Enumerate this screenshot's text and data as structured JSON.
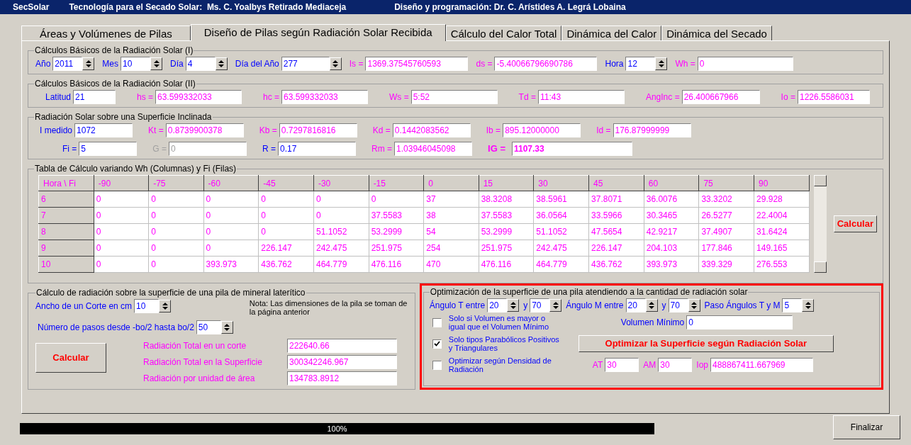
{
  "title_bar": {
    "app": "SecSolar",
    "subtitle": "Tecnología para el Secado Solar:  Ms. C. Yoalbys Retirado Mediaceja",
    "credits": "Diseño y programación: Dr. C. Arístides A. Legrá Lobaina"
  },
  "tabs": [
    {
      "label": "Áreas y Volúmenes de Pilas",
      "selected": false
    },
    {
      "label": "Diseño de Pilas según Radiación Solar Recibida",
      "selected": true
    },
    {
      "label": "Cálculo del Calor Total",
      "selected": false
    },
    {
      "label": "Dinámica del Calor",
      "selected": false
    },
    {
      "label": "Dinámica del Secado",
      "selected": false
    }
  ],
  "basic_1": {
    "title": "Cálculos Básicos de la Radiación Solar (I)",
    "fields": [
      {
        "label": "Año",
        "value": "2011",
        "kind": "spin"
      },
      {
        "label": "Mes",
        "value": "10",
        "kind": "spin"
      },
      {
        "label": "Día",
        "value": "4",
        "kind": "spin"
      },
      {
        "label": "Día del Año",
        "value": "277",
        "kind": "spin"
      },
      {
        "label": "Is =",
        "value": "1369.37545760593",
        "kind": "output"
      },
      {
        "label": "ds =",
        "value": "-5.40066796690786",
        "kind": "output"
      },
      {
        "label": "Hora",
        "value": "12",
        "kind": "spin"
      },
      {
        "label": "Wh =",
        "value": "0",
        "kind": "output"
      }
    ]
  },
  "basic_2": {
    "title": "Cálculos Básicos de la Radiación Solar (II)",
    "fields": [
      {
        "label": "Latitud",
        "value": "21",
        "kind": "input"
      },
      {
        "label": "hs =",
        "value": "63.599332033",
        "kind": "output"
      },
      {
        "label": "hc =",
        "value": "63.599332033",
        "kind": "output"
      },
      {
        "label": "Ws =",
        "value": "5:52",
        "kind": "output"
      },
      {
        "label": "Td =",
        "value": "11:43",
        "kind": "output"
      },
      {
        "label": "AngInc =",
        "value": "26.400667966",
        "kind": "output"
      },
      {
        "label": "Io =",
        "value": "1226.5586031",
        "kind": "output"
      }
    ]
  },
  "inclined": {
    "title": "Radiación Solar sobre una Superficie Inclinada",
    "rows": [
      [
        {
          "label": "I medido",
          "value": "1072",
          "kind": "input"
        },
        {
          "label": "Kt =",
          "value": "0.8739900378",
          "kind": "output"
        },
        {
          "label": "Kb =",
          "value": "0.7297816816",
          "kind": "output"
        },
        {
          "label": "Kd =",
          "value": "0.1442083562",
          "kind": "output"
        },
        {
          "label": "Ib =",
          "value": "895.12000000",
          "kind": "output"
        },
        {
          "label": "Id =",
          "value": "176.87999999",
          "kind": "output"
        }
      ],
      [
        {
          "label": "Fi =",
          "value": "5",
          "kind": "input"
        },
        {
          "label": "G =",
          "value": "0",
          "kind": "disabled"
        },
        {
          "label": "R =",
          "value": "0.17",
          "kind": "input"
        },
        {
          "label": "Rm =",
          "value": "1.03946045098",
          "kind": "output"
        },
        {
          "label": "IG =",
          "value": "1107.33",
          "kind": "result"
        }
      ]
    ]
  },
  "table": {
    "title": "Tabla de Cálculo variando Wh (Columnas) y Fi (Filas)",
    "columns": [
      "Hora \\ Fi",
      "-90",
      "-75",
      "-60",
      "-45",
      "-30",
      "-15",
      "0",
      "15",
      "30",
      "45",
      "60",
      "75",
      "90"
    ],
    "rows": [
      {
        "cells": [
          "6",
          "0",
          "0",
          "0",
          "0",
          "0",
          "0",
          "37",
          "38.3208",
          "38.5961",
          "37.8071",
          "36.0076",
          "33.3202",
          "29.928"
        ]
      },
      {
        "cells": [
          "7",
          "0",
          "0",
          "0",
          "0",
          "0",
          "37.5583",
          "38",
          "37.5583",
          "36.0564",
          "33.5966",
          "30.3465",
          "26.5277",
          "22.4004"
        ]
      },
      {
        "cells": [
          "8",
          "0",
          "0",
          "0",
          "0",
          "51.1052",
          "53.2999",
          "54",
          "53.2999",
          "51.1052",
          "47.5654",
          "42.9217",
          "37.4907",
          "31.6424"
        ]
      },
      {
        "cells": [
          "9",
          "0",
          "0",
          "0",
          "226.147",
          "242.475",
          "251.975",
          "254",
          "251.975",
          "242.475",
          "226.147",
          "204.103",
          "177.846",
          "149.165"
        ]
      },
      {
        "cells": [
          "10",
          "0",
          "0",
          "393.973",
          "436.762",
          "464.779",
          "476.116",
          "470",
          "476.116",
          "464.779",
          "436.762",
          "393.973",
          "339.329",
          "276.553"
        ]
      }
    ],
    "button": "Calcular"
  },
  "pile": {
    "title": "Cálculo de radiación sobre la superficie de una pila de mineral laterítico",
    "width_field": {
      "label": "Ancho de un Corte en cm",
      "value": "10",
      "kind": "spin"
    },
    "note": "Nota: Las dimensiones de la pila se toman de la página anterior",
    "steps_field": {
      "label": "Número de pasos desde -bo/2 hasta bo/2",
      "value": "50",
      "kind": "spin"
    },
    "button": "Calcular",
    "outputs": [
      {
        "label": "Radiación Total en un corte",
        "value": "222640.66",
        "kind": "output"
      },
      {
        "label": "Radiación Total en la Superficie",
        "value": "300342246.967",
        "kind": "output"
      },
      {
        "label": "Radiación por unidad de área",
        "value": "134783.8912",
        "kind": "output"
      }
    ]
  },
  "optimization": {
    "title": "Optimización de la superficie de una pila atendiendo a la cantidad de radiación solar",
    "angles": [
      {
        "label": "Ángulo T entre",
        "value": "20",
        "kind": "spin"
      },
      {
        "label": "y",
        "value": "70",
        "kind": "spin"
      },
      {
        "label": "Ángulo M entre",
        "value": "20",
        "kind": "spin"
      },
      {
        "label": "y",
        "value": "70",
        "kind": "spin"
      },
      {
        "label": "Paso Ángulos T y M",
        "value": "5",
        "kind": "spin"
      }
    ],
    "options": [
      {
        "label": "Solo si Volumen es mayor o igual que el Volumen Mínimo",
        "checked": false
      },
      {
        "label": "Solo tipos Parabólicos Positivos y Triangulares",
        "checked": true
      },
      {
        "label": "Optimizar según Densidad de Radiación",
        "checked": false
      }
    ],
    "min_volume": {
      "label": "Volumen Mínimo",
      "value": "0",
      "kind": "input"
    },
    "button": "Optimizar la Superficie según Radiación Solar",
    "results": [
      {
        "label": "AT",
        "value": "30",
        "kind": "output"
      },
      {
        "label": "AM",
        "value": "30",
        "kind": "output"
      },
      {
        "label": "Iop",
        "value": "488867411.667969",
        "kind": "output"
      }
    ]
  },
  "progress": {
    "label": "100%",
    "level": 1
  },
  "finish_button": "Finalizar"
}
